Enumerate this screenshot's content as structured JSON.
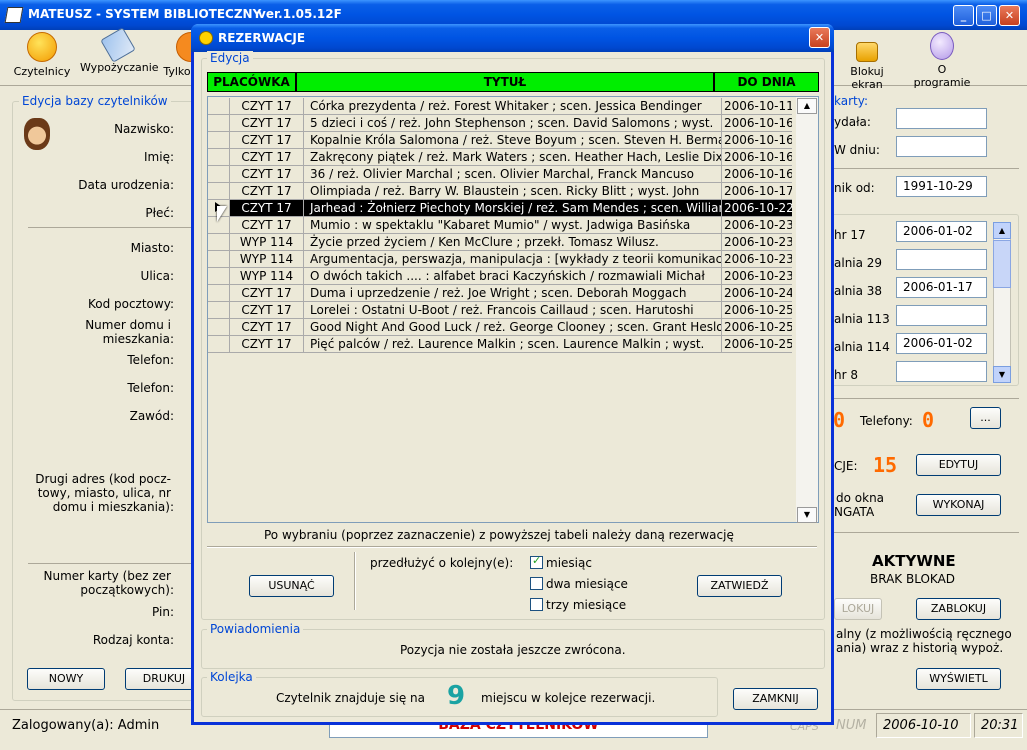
{
  "app": {
    "title": "MATEUSZ - SYSTEM BIBLIOTECZNY",
    "version": "ver.1.05.12F",
    "controls": {
      "minimize": "_",
      "maximize": "□",
      "close": "✕"
    }
  },
  "toolbar": {
    "czytelnicy": "Czytelnicy",
    "wypozyczanie": "Wypożyczanie",
    "tylko": "Tylko",
    "blokuj_ekran": "Blokuj ekran",
    "o_programie": "O programie"
  },
  "left_panel": {
    "group_title": "Edycja bazy czytelników",
    "labels": {
      "nazwisko": "Nazwisko:",
      "imie": "Imię:",
      "data_urodzenia": "Data urodzenia:",
      "plec": "Płeć:",
      "miasto": "Miasto:",
      "ulica": "Ulica:",
      "kod_pocztowy": "Kod pocztowy:",
      "numer_domu_1": "Numer domu i",
      "numer_domu_2": "mieszkania:",
      "telefon1": "Telefon:",
      "telefon2": "Telefon:",
      "zawod": "Zawód:",
      "drugi_adres_1": "Drugi adres (kod pocz-",
      "drugi_adres_2": "towy, miasto, ulica, nr",
      "drugi_adres_3": "domu i mieszkania):",
      "numer_karty_1": "Numer karty  (bez zer",
      "numer_karty_2": "początkowych):",
      "pin": "Pin:",
      "rodzaj_konta": "Rodzaj konta:"
    },
    "buttons": {
      "nowy": "NOWY",
      "drukuj": "DRUKUJ"
    }
  },
  "right_panel": {
    "karty_title": "karty:",
    "wydala": "ydała:",
    "w_dniu": "W dniu:",
    "nik_od": "nik od:",
    "nik_od_value": "1991-10-29",
    "list_items": [
      {
        "label": "hr 17",
        "value": "2006-01-02"
      },
      {
        "label": "alnia 29",
        "value": ""
      },
      {
        "label": "alnia 38",
        "value": "2006-01-17"
      },
      {
        "label": "alnia 113",
        "value": ""
      },
      {
        "label": "alnia 114",
        "value": "2006-01-02"
      },
      {
        "label": "hr 8",
        "value": ""
      }
    ],
    "telefony_label": "Telefony:",
    "telefony_count": "0",
    "left_count": "0",
    "dots_button": "...",
    "cje_label": "CJE:",
    "cje_count": "15",
    "edytuj": "EDYTUJ",
    "do_okna_1": "do okna",
    "do_okna_2": "NGATA",
    "wykonaj": "WYKONAJ",
    "aktywne": "AKTYWNE",
    "brak_blokad": "BRAK BLOKAD",
    "odblokuj": "LOKUJ",
    "zablokuj": "ZABLOKUJ",
    "historia_1": "alny (z możliwością ręcznego",
    "historia_2": "ania) wraz z historią wypoż.",
    "wyswietl": "WYŚWIETL"
  },
  "status_bar": {
    "logged": "Zalogowany(a): Admin",
    "center": "BAZA CZYTELNIKÓW",
    "caps": "CAPS",
    "num": "NUM",
    "date": "2006-10-10",
    "time": "20:31"
  },
  "dialog": {
    "title": "REZERWACJE",
    "close": "✕",
    "edycja_title": "Edycja",
    "headers": {
      "placowka": "PLACÓWKA",
      "tytul": "TYTUŁ",
      "do_dnia": "DO DNIA"
    },
    "rows": [
      {
        "placowka": "CZYT 17",
        "tytul": "Córka prezydenta /    reż. Forest Whitaker ; scen. Jessica Bendinger",
        "do_dnia": "2006-10-11"
      },
      {
        "placowka": "CZYT 17",
        "tytul": "5 dzieci i coś /    reż. John Stephenson ; scen. David Salomons ; wyst.",
        "do_dnia": "2006-10-16"
      },
      {
        "placowka": "CZYT 17",
        "tytul": "Kopalnie Króla Salomona /    reż. Steve Boyum ; scen. Steven H. Berman",
        "do_dnia": "2006-10-16"
      },
      {
        "placowka": "CZYT 17",
        "tytul": "Zakręcony piątek /    reż. Mark Waters ; scen. Heather Hach, Leslie Dixon",
        "do_dnia": "2006-10-16"
      },
      {
        "placowka": "CZYT 17",
        "tytul": "36 /    reż. Olivier Marchal ; scen. Olivier Marchal, Franck Mancuso",
        "do_dnia": "2006-10-16"
      },
      {
        "placowka": "CZYT 17",
        "tytul": "Olimpiada /    reż. Barry W. Blaustein ; scen. Ricky Blitt ; wyst. John",
        "do_dnia": "2006-10-17"
      },
      {
        "placowka": "CZYT 17",
        "tytul": "Jarhead : Żołnierz Piechoty Morskiej /    reż. Sam Mendes ; scen. William",
        "do_dnia": "2006-10-22",
        "selected": true
      },
      {
        "placowka": "CZYT 17",
        "tytul": "Mumio : w spektaklu \"Kabaret Mumio\" /    wyst. Jadwiga Basińska",
        "do_dnia": "2006-10-23"
      },
      {
        "placowka": "WYP 114",
        "tytul": "Życie przed życiem /    Ken McClure ; przekł. Tomasz Wilusz.",
        "do_dnia": "2006-10-23"
      },
      {
        "placowka": "WYP 114",
        "tytul": "Argumentacja, perswazja, manipulacja : [wykłady z teorii komunikacji]",
        "do_dnia": "2006-10-23"
      },
      {
        "placowka": "WYP 114",
        "tytul": "O dwóch takich .... : alfabet braci Kaczyńskich /    rozmawiali Michał",
        "do_dnia": "2006-10-23"
      },
      {
        "placowka": "CZYT 17",
        "tytul": "Duma i uprzedzenie /    reż. Joe Wright ; scen. Deborah Moggach",
        "do_dnia": "2006-10-24"
      },
      {
        "placowka": "CZYT 17",
        "tytul": "Lorelei : Ostatni U-Boot /    reż. Francois Caillaud ; scen. Harutoshi",
        "do_dnia": "2006-10-25"
      },
      {
        "placowka": "CZYT 17",
        "tytul": "Good Night And Good Luck /    reż. George Clooney ; scen. Grant Heslov",
        "do_dnia": "2006-10-25"
      },
      {
        "placowka": "CZYT 17",
        "tytul": "Pięć palców /    reż. Laurence Malkin ; scen. Laurence Malkin ; wyst.",
        "do_dnia": "2006-10-25"
      }
    ],
    "hint": "Po wybraniu (poprzez zaznaczenie) z powyższej tabeli należy daną rezerwację",
    "usun": "USUNĄĆ",
    "przedluz": "przedłużyć o kolejny(e):",
    "options": [
      {
        "label": "miesiąc",
        "checked": true
      },
      {
        "label": "dwa miesiące",
        "checked": false
      },
      {
        "label": "trzy miesiące",
        "checked": false
      }
    ],
    "zatwierdz": "ZATWIEDŹ",
    "powiadomienia_title": "Powiadomienia",
    "powiadomienia_text": "Pozycja nie została jeszcze zwrócona.",
    "kolejka_title": "Kolejka",
    "kolejka_before": "Czytelnik znajduje się na",
    "kolejka_number": "9",
    "kolejka_after": "miejscu w kolejce rezerwacji.",
    "zamknij": "ZAMKNIJ"
  },
  "icons": {
    "scroll_up": "▲",
    "scroll_down": "▼",
    "check": "✓"
  }
}
